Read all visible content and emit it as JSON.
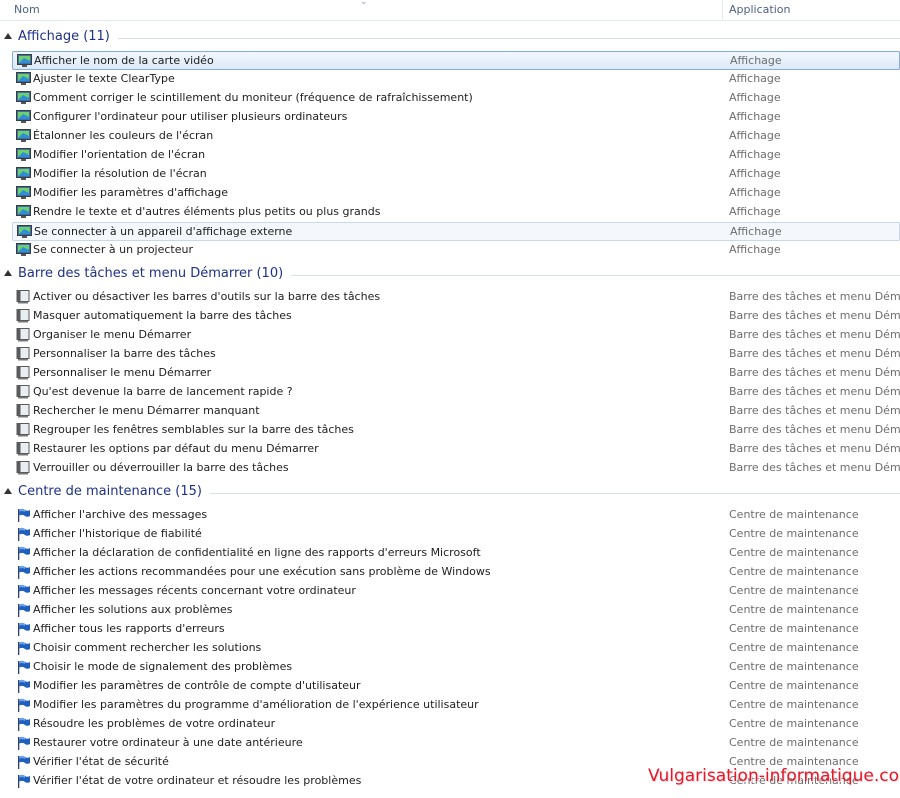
{
  "columns": {
    "name": "Nom",
    "application": "Application"
  },
  "colors": {
    "group_header": "#1e3287",
    "selection_border": "#84acdd",
    "app_text": "#6d6d6d",
    "watermark": "#e2182b"
  },
  "groups": [
    {
      "title": "Affichage (11)",
      "icon": "monitor-icon",
      "items": [
        {
          "name": "Afficher le nom de la carte vidéo",
          "app": "Affichage",
          "state": "selected"
        },
        {
          "name": "Ajuster le texte ClearType",
          "app": "Affichage"
        },
        {
          "name": "Comment corriger le scintillement du moniteur (fréquence de rafraîchissement)",
          "app": "Affichage"
        },
        {
          "name": "Configurer l'ordinateur pour utiliser plusieurs ordinateurs",
          "app": "Affichage"
        },
        {
          "name": "Étalonner les couleurs de l'écran",
          "app": "Affichage"
        },
        {
          "name": "Modifier l'orientation de l'écran",
          "app": "Affichage"
        },
        {
          "name": "Modifier la résolution de l'écran",
          "app": "Affichage"
        },
        {
          "name": "Modifier les paramètres d'affichage",
          "app": "Affichage"
        },
        {
          "name": "Rendre le texte et d'autres éléments plus petits ou plus grands",
          "app": "Affichage"
        },
        {
          "name": "Se connecter à un appareil d'affichage externe",
          "app": "Affichage",
          "state": "hover"
        },
        {
          "name": "Se connecter à un projecteur",
          "app": "Affichage"
        }
      ]
    },
    {
      "title": "Barre des tâches et menu Démarrer (10)",
      "icon": "taskbar-icon",
      "items": [
        {
          "name": "Activer ou désactiver les barres d'outils sur la barre des tâches",
          "app": "Barre des tâches et menu Démarrer"
        },
        {
          "name": "Masquer automatiquement la barre des tâches",
          "app": "Barre des tâches et menu Démarrer"
        },
        {
          "name": "Organiser le menu Démarrer",
          "app": "Barre des tâches et menu Démarrer"
        },
        {
          "name": "Personnaliser la barre des tâches",
          "app": "Barre des tâches et menu Démarrer"
        },
        {
          "name": "Personnaliser le menu Démarrer",
          "app": "Barre des tâches et menu Démarrer"
        },
        {
          "name": "Qu'est devenue la barre de lancement rapide ?",
          "app": "Barre des tâches et menu Démarrer"
        },
        {
          "name": "Rechercher le menu Démarrer manquant",
          "app": "Barre des tâches et menu Démarrer"
        },
        {
          "name": "Regrouper les fenêtres semblables sur la barre des tâches",
          "app": "Barre des tâches et menu Démarrer"
        },
        {
          "name": "Restaurer les options par défaut du menu Démarrer",
          "app": "Barre des tâches et menu Démarrer"
        },
        {
          "name": "Verrouiller ou déverrouiller la barre des tâches",
          "app": "Barre des tâches et menu Démarrer"
        }
      ]
    },
    {
      "title": "Centre de maintenance (15)",
      "icon": "flag-icon",
      "items": [
        {
          "name": "Afficher l'archive des messages",
          "app": "Centre de maintenance"
        },
        {
          "name": "Afficher l'historique de fiabilité",
          "app": "Centre de maintenance"
        },
        {
          "name": "Afficher la déclaration de confidentialité en ligne des rapports d'erreurs Microsoft",
          "app": "Centre de maintenance"
        },
        {
          "name": "Afficher les actions recommandées pour une exécution sans problème de Windows",
          "app": "Centre de maintenance"
        },
        {
          "name": "Afficher les messages récents concernant votre ordinateur",
          "app": "Centre de maintenance"
        },
        {
          "name": "Afficher les solutions aux problèmes",
          "app": "Centre de maintenance"
        },
        {
          "name": "Afficher tous les rapports d'erreurs",
          "app": "Centre de maintenance"
        },
        {
          "name": "Choisir comment rechercher les solutions",
          "app": "Centre de maintenance"
        },
        {
          "name": "Choisir le mode de signalement des problèmes",
          "app": "Centre de maintenance"
        },
        {
          "name": "Modifier les paramètres de contrôle de compte d'utilisateur",
          "app": "Centre de maintenance"
        },
        {
          "name": "Modifier les paramètres du programme d'amélioration de l'expérience utilisateur",
          "app": "Centre de maintenance"
        },
        {
          "name": "Résoudre les problèmes de votre ordinateur",
          "app": "Centre de maintenance"
        },
        {
          "name": "Restaurer votre ordinateur à une date antérieure",
          "app": "Centre de maintenance"
        },
        {
          "name": "Vérifier l'état de sécurité",
          "app": "Centre de maintenance"
        },
        {
          "name": "Vérifier l'état de votre ordinateur et résoudre les problèmes",
          "app": "Centre de maintenance"
        }
      ]
    }
  ],
  "watermark": "Vulgarisation-informatique.com"
}
